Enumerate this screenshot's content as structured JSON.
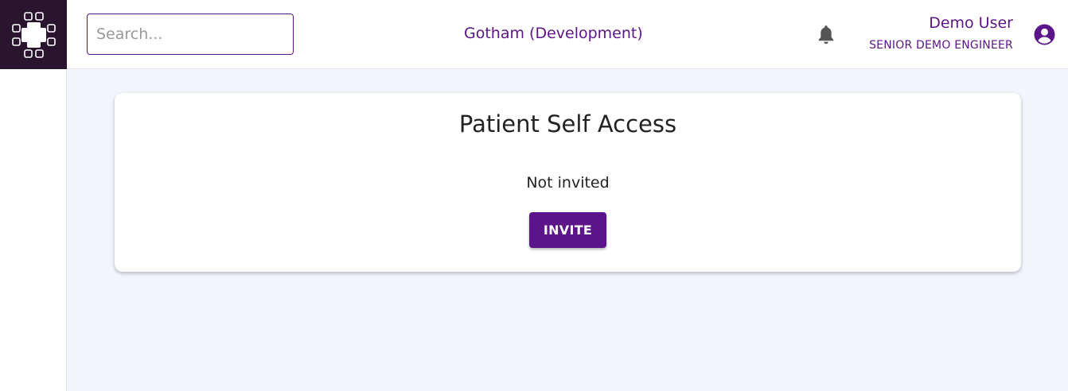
{
  "header": {
    "logo_icon": "medical-cross-logo-icon",
    "search": {
      "placeholder": "Search...",
      "value": ""
    },
    "org_name": "Gotham (Development)",
    "notification_icon": "bell-icon",
    "user": {
      "name": "Demo User",
      "role": "SENIOR DEMO ENGINEER",
      "avatar_icon": "user-circle-icon"
    }
  },
  "card": {
    "title": "Patient Self Access",
    "status": "Not invited",
    "invite_label": "INVITE"
  },
  "colors": {
    "brand": "#5b1489",
    "logo_bg": "#2a1430",
    "main_bg": "#f3f5fd",
    "bell": "#555555"
  }
}
